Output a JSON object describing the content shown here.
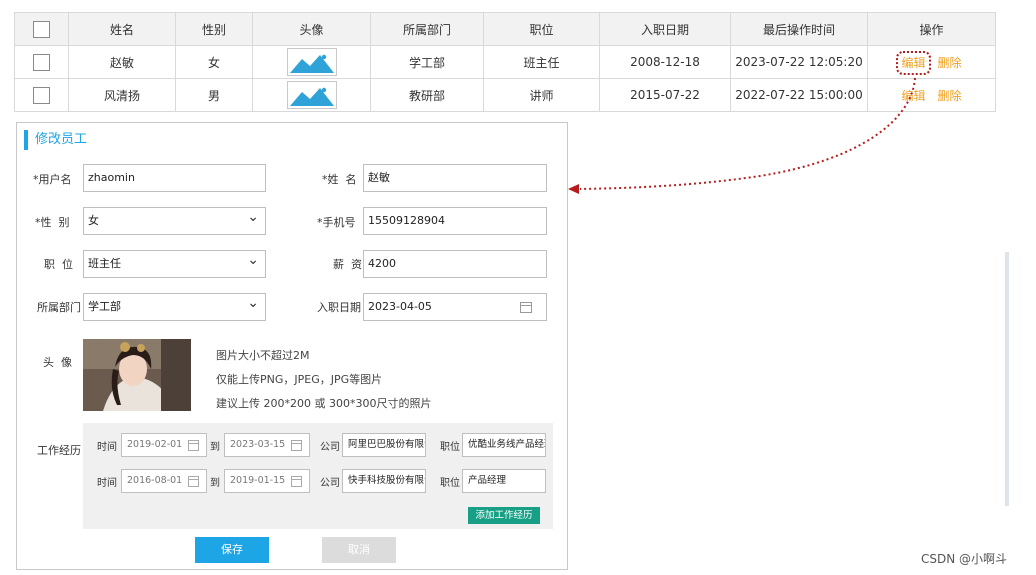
{
  "table": {
    "headers": [
      "",
      "姓名",
      "性别",
      "头像",
      "所属部门",
      "职位",
      "入职日期",
      "最后操作时间",
      "操作"
    ],
    "rows": [
      {
        "name": "赵敏",
        "gender": "女",
        "dept": "学工部",
        "position": "班主任",
        "entry_date": "2008-12-18",
        "last_op": "2023-07-22 12:05:20",
        "edit": "编辑",
        "delete": "删除"
      },
      {
        "name": "风清扬",
        "gender": "男",
        "dept": "教研部",
        "position": "讲师",
        "entry_date": "2015-07-22",
        "last_op": "2022-07-22 15:00:00",
        "edit": "编辑",
        "delete": "删除"
      }
    ],
    "action_color": "#f0a020"
  },
  "form": {
    "title": "修改员工",
    "username_label": "*用户名",
    "username_value": "zhaomin",
    "name_label": "*姓  名",
    "name_value": "赵敏",
    "gender_label": "*性  别",
    "gender_value": "女",
    "phone_label": "*手机号",
    "phone_value": "15509128904",
    "position_label": "职  位",
    "position_value": "班主任",
    "salary_label": "薪  资",
    "salary_value": "4200",
    "dept_label": "所属部门",
    "dept_value": "学工部",
    "entry_label": "入职日期",
    "entry_value": "2023-04-05",
    "avatar_label": "头  像",
    "hint1": "图片大小不超过2M",
    "hint2": "仅能上传PNG，JPEG，JPG等图片",
    "hint3": "建议上传 200*200 或 300*300尺寸的照片",
    "work_label": "工作经历",
    "work_time_label": "时间",
    "work_to_label": "到",
    "work_company_label": "公司",
    "work_position_label": "职位",
    "work": [
      {
        "start": "2019-02-01",
        "end": "2023-03-15",
        "company": "阿里巴巴股份有限公司",
        "position": "优酷业务线产品经理"
      },
      {
        "start": "2016-08-01",
        "end": "2019-01-15",
        "company": "快手科技股份有限公司",
        "position": "产品经理"
      }
    ],
    "add_work_label": "添加工作经历",
    "save_label": "保存",
    "cancel_label": "取消",
    "accent_color": "#1ea5e6"
  },
  "watermark": "CSDN @小啊斗"
}
